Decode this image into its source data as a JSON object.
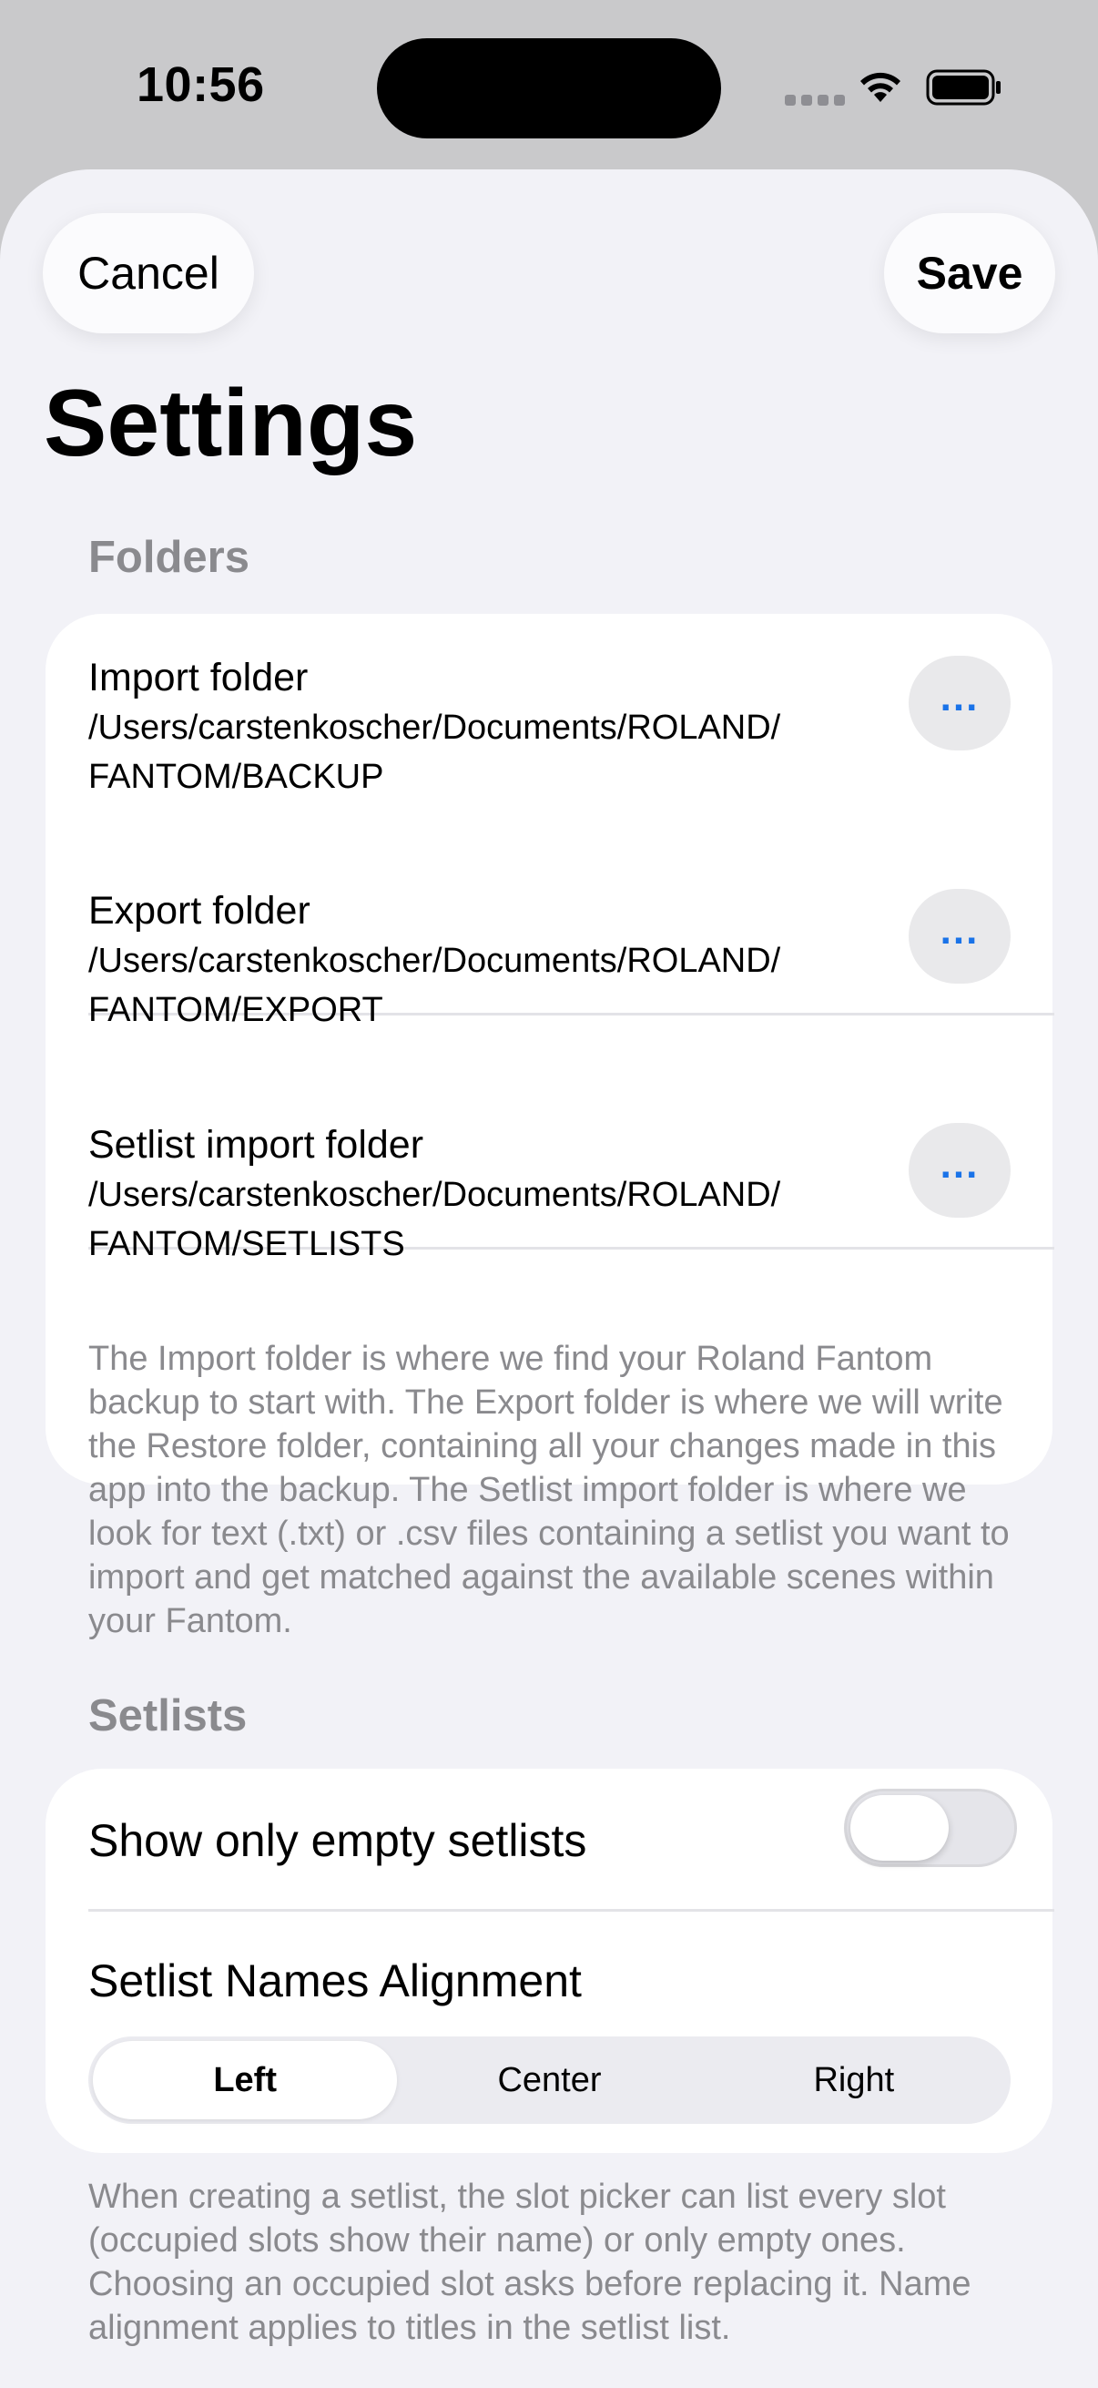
{
  "status_bar": {
    "time": "10:56"
  },
  "nav": {
    "cancel_label": "Cancel",
    "save_label": "Save"
  },
  "page_title": "Settings",
  "folders": {
    "header": "Folders",
    "items": [
      {
        "title": "Import folder",
        "path_line1": "/Users/carstenkoscher/Documents/ROLAND/",
        "path_line2": "FANTOM/BACKUP",
        "button_label": "..."
      },
      {
        "title": "Export folder",
        "path_line1": "/Users/carstenkoscher/Documents/ROLAND/",
        "path_line2": "FANTOM/EXPORT",
        "button_label": "..."
      },
      {
        "title": "Setlist import folder",
        "path_line1": "/Users/carstenkoscher/Documents/ROLAND/",
        "path_line2": "FANTOM/SETLISTS",
        "button_label": "..."
      }
    ],
    "footnote": "The Import folder is where we find your Roland Fantom backup to start with. The Export folder is where we will write the Restore folder, containing all your changes made in this app into the backup. The Setlist import folder is where we look for text (.txt) or .csv files containing a setlist you want to import and get matched against the available scenes within your Fantom."
  },
  "setlists": {
    "header": "Setlists",
    "toggle_label": "Show only empty setlists",
    "toggle_on": false,
    "alignment_label": "Setlist Names Alignment",
    "alignment_options": [
      "Left",
      "Center",
      "Right"
    ],
    "alignment_selected": "Left",
    "footnote": "When creating a setlist, the slot picker can list every slot (occupied slots show their name) or only empty ones. Choosing an occupied slot asks before replacing it. Name alignment applies to titles in the setlist list."
  },
  "colors": {
    "accent": "#1a73e8",
    "background": "#f2f2f7",
    "card": "#ffffff",
    "secondary_text": "#8a8a8e"
  },
  "icons": [
    "wifi-icon",
    "battery-icon",
    "cellular-signal-icon"
  ]
}
